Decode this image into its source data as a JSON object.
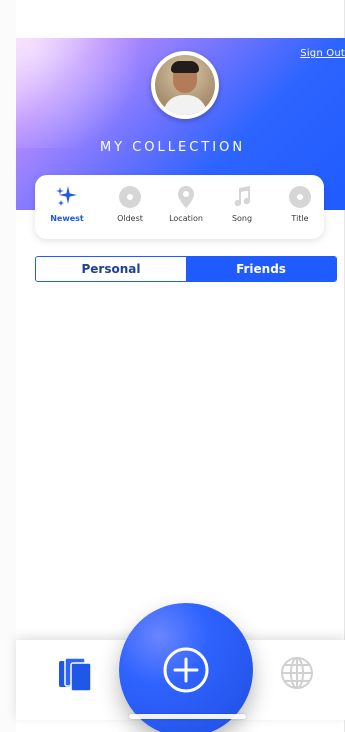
{
  "header": {
    "sign_out_label": "Sign Out",
    "collection_title": "MY COLLECTION",
    "gradient_colors": [
      "#f4c6ff",
      "#6a72ff",
      "#1f5bff"
    ]
  },
  "sort_options": {
    "items": [
      {
        "label": "Newest",
        "icon": "sparkles-icon",
        "active": true
      },
      {
        "label": "Oldest",
        "icon": "disc-icon",
        "active": false
      },
      {
        "label": "Location",
        "icon": "location-pin-icon",
        "active": false
      },
      {
        "label": "Song",
        "icon": "music-note-icon",
        "active": false
      },
      {
        "label": "Title",
        "icon": "disc-icon",
        "active": false
      }
    ],
    "active_color": "#1f57e6",
    "inactive_icon_color": "#d6d6d6"
  },
  "segmented_control": {
    "tabs": [
      {
        "label": "Personal",
        "selected": false
      },
      {
        "label": "Friends",
        "selected": true
      }
    ],
    "accent_color": "#1f5bff"
  },
  "bottom_bar": {
    "left_icon": "stacked-cards-icon",
    "center_icon": "add-icon",
    "right_icon": "globe-icon"
  }
}
